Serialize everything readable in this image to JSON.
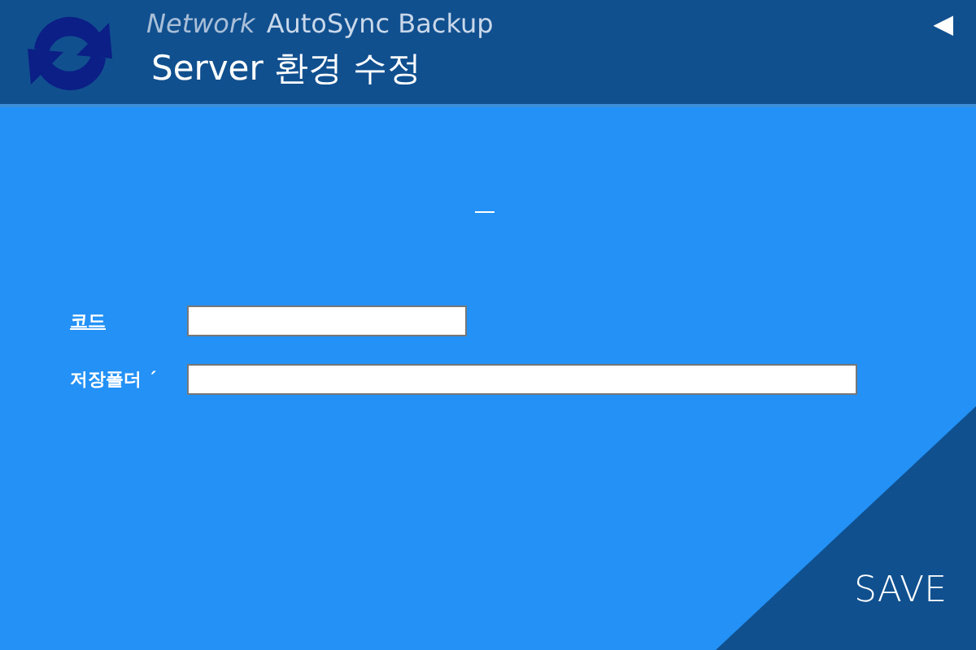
{
  "header": {
    "title_prefix": "Network",
    "title": "AutoSync Backup",
    "subtitle": "Server 환경 수정",
    "back": "◀"
  },
  "fields": [
    {
      "label": "코드",
      "underlined": true,
      "wide": false
    },
    {
      "label": "저장폴더 ´",
      "underlined": false,
      "wide": true
    }
  ],
  "save_button": "SAVE"
}
